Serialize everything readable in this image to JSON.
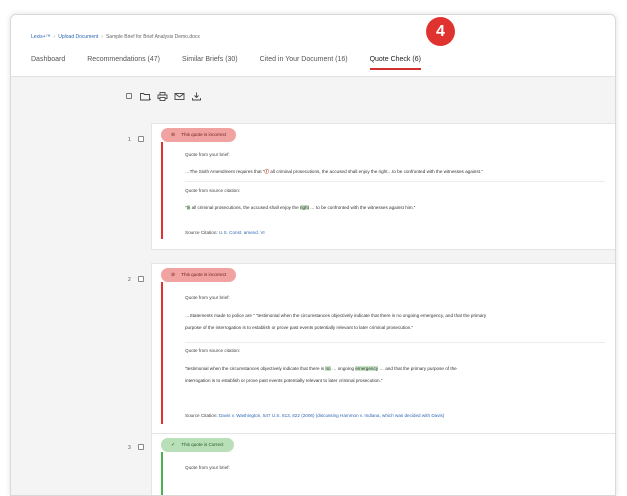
{
  "breadcrumb": {
    "items": [
      "Lexis+™",
      "Upload Document",
      "Sample Brief for Brief Analysis Demo.docx"
    ]
  },
  "tabs": [
    {
      "label": "Dashboard",
      "active": false
    },
    {
      "label": "Recommendations (47)",
      "active": false
    },
    {
      "label": "Similar Briefs (30)",
      "active": false
    },
    {
      "label": "Cited in Your Document (16)",
      "active": false
    },
    {
      "label": "Quote Check (6)",
      "active": true
    }
  ],
  "step_badge": "4",
  "toolbar": {
    "icons": [
      "select-all-checkbox",
      "folder-icon",
      "print-icon",
      "email-icon",
      "download-icon"
    ]
  },
  "quotes": [
    {
      "number": "1",
      "status": "This quote is incorrect",
      "status_kind": "incorrect",
      "brief_label": "Quote from your brief:",
      "brief_prefix": "…The Sixth Amendment requires that “",
      "brief_marker": "Ⓘ",
      "brief_quote": " all criminal prosecutions, the accused shall enjoy the right…to be confronted with the witnesses against.”",
      "source_label": "Quote from source citation:",
      "source_pre": "“",
      "source_mark1": "In",
      "source_mid": " all criminal prosecutions, the accused shall enjoy the ",
      "source_mark2": "right",
      "source_post": " … to be confronted with the witnesses against him.”",
      "citation_label": "Source Citation:",
      "citation": "U.S. Const. amend. VI"
    },
    {
      "number": "2",
      "status": "This quote is incorrect",
      "status_kind": "incorrect",
      "brief_label": "Quote from your brief:",
      "brief_line1": "…Statements made to police are “ “testimonial when the circumstances objectively indicate that there is no ongoing emergency, and that the primary",
      "brief_line2": "purpose of the interrogation is to establish or prove past events potentially relevant to later criminal prosecution.”",
      "source_label": "Quote from source citation:",
      "source_pre": "“testimonial when the circumstances objectively indicate that there is ",
      "source_mark1": "no",
      "source_mid": " … ongoing ",
      "source_mark2": "emergency",
      "source_post": " … and that the primary purpose of the",
      "source_line2": "interrogation is to establish or prove past events potentially relevant to later criminal prosecution.”",
      "citation_label": "Source Citation:",
      "citation": "Davis v. Washington, 547 U.S. 813, 822 (2006) (discussing Hammon v. Indiana, which was decided with Davis)"
    },
    {
      "number": "3",
      "status": "This quote is Correct",
      "status_kind": "correct",
      "brief_label": "Quote from your brief:"
    }
  ],
  "colors": {
    "incorrect_pill": "#f0a3a1",
    "correct_pill": "#b9dfb8",
    "accent_red": "#e0322f",
    "link_blue": "#2f66b3"
  }
}
